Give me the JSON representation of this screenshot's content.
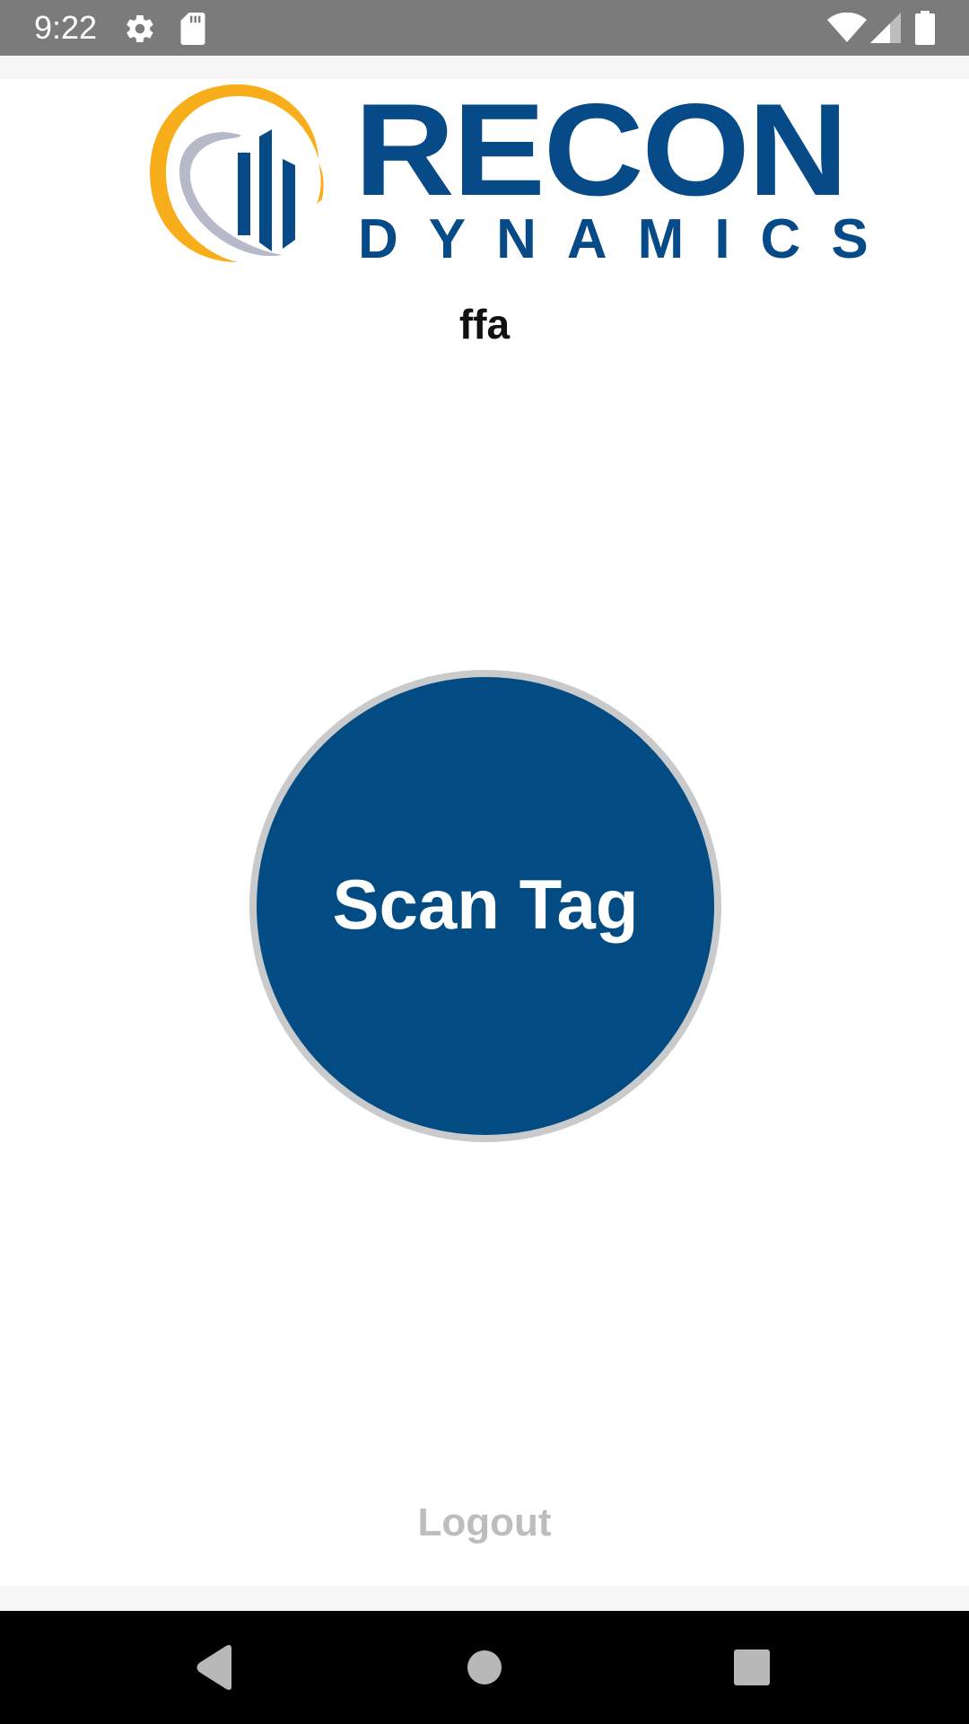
{
  "status_bar": {
    "time": "9:22",
    "left_icons": [
      "settings-gear-icon",
      "sd-card-icon"
    ],
    "right_icons": [
      "wifi-icon",
      "cellular-signal-icon",
      "battery-icon"
    ]
  },
  "logo": {
    "title": "RECON",
    "subtitle": "DYNAMICS",
    "colors": {
      "brand_blue": "#064a87",
      "arc_orange": "#f8ae1a",
      "arc_gray": "#b5b9c8"
    }
  },
  "user": {
    "name": "ffa"
  },
  "scan_button": {
    "label": "Scan Tag",
    "color": "#024b83",
    "ring_color": "#c9cacc"
  },
  "logout": {
    "label": "Logout",
    "color": "#bdbdbd"
  },
  "nav_bar": {
    "buttons": [
      "back-icon",
      "home-icon",
      "recents-icon"
    ]
  }
}
